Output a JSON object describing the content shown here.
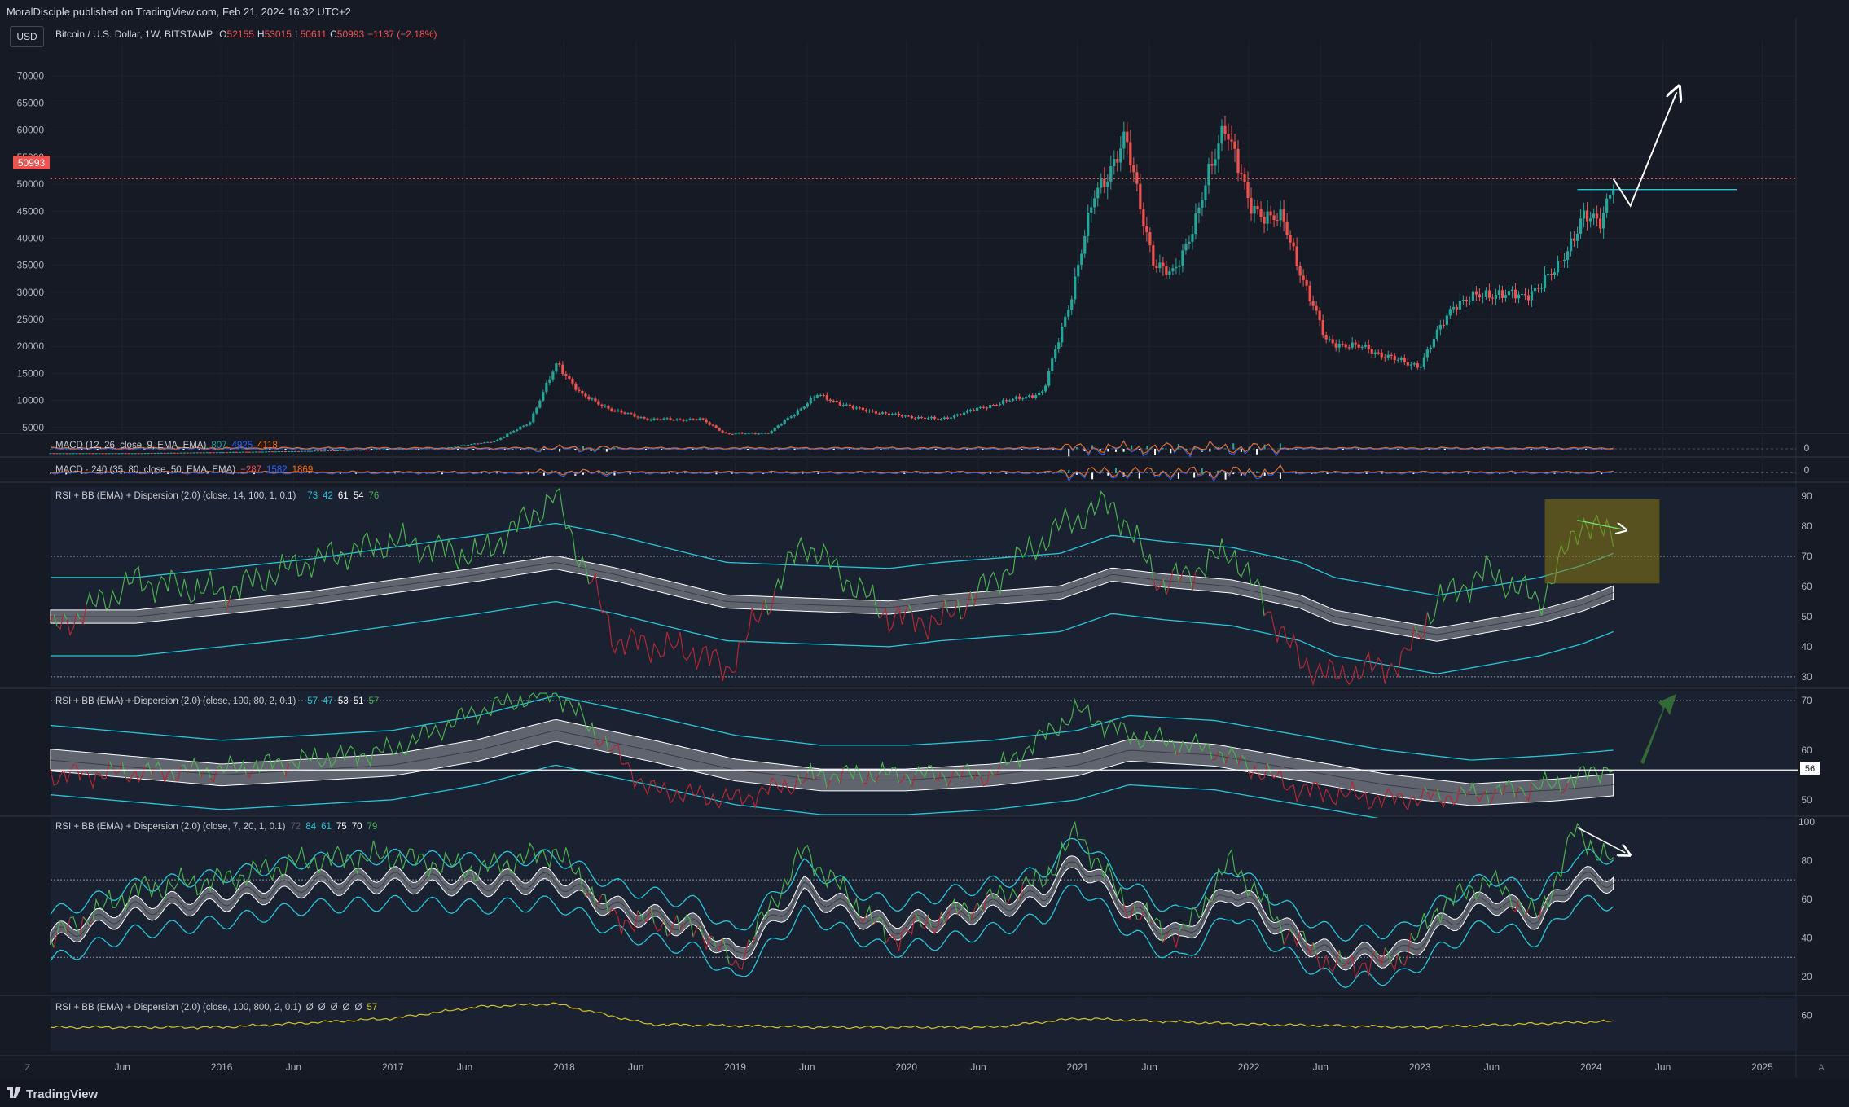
{
  "header": {
    "published": "MoralDisciple published on TradingView.com, Feb 21, 2024 16:32 UTC+2",
    "currency_button": "USD"
  },
  "symbol": {
    "name": "Bitcoin / U.S. Dollar, 1W, BITSTAMP",
    "open_label": "O",
    "open": "52155",
    "high_label": "H",
    "high": "53015",
    "low_label": "L",
    "low": "50611",
    "close_label": "C",
    "close": "50993",
    "change": "−1137 (−2.18%)",
    "last_price_badge": "50993"
  },
  "panes": {
    "macd1": {
      "label": "MACD (12, 26, close, 9, EMA, EMA)",
      "v1": "807",
      "v2": "4925",
      "v3": "4118",
      "zero": "0"
    },
    "macd2": {
      "label": "MACD · 240 (35, 80, close, 50, EMA, EMA)",
      "v1": "−287",
      "v2": "1582",
      "v3": "1869",
      "zero": "0"
    },
    "rsi1": {
      "label": "RSI + BB (EMA) + Dispersion (2.0) (close, 14, 100, 1, 0.1)",
      "values": [
        "73",
        "42",
        "61",
        "54",
        "76"
      ]
    },
    "rsi2": {
      "label": "RSI + BB (EMA) + Dispersion (2.0) (close, 100, 80, 2, 0.1)",
      "values": [
        "57",
        "47",
        "53",
        "51",
        "57"
      ],
      "level_badge": "56"
    },
    "rsi3": {
      "label": "RSI + BB (EMA) + Dispersion (2.0) (close, 7, 20, 1, 0.1)",
      "values": [
        "72",
        "84",
        "61",
        "75",
        "70",
        "79"
      ]
    },
    "rsi4": {
      "label": "RSI + BB (EMA) + Dispersion (2.0) (close, 100, 800, 2, 0.1)",
      "values": [
        "Ø",
        "Ø",
        "Ø",
        "Ø",
        "Ø",
        "57"
      ]
    }
  },
  "footer": {
    "brand": "TradingView",
    "z_button": "Z",
    "a_button": "A"
  },
  "colors": {
    "background": "#161a25",
    "up_candle": "#26a69a",
    "down_candle": "#ef5350",
    "rsi_up": "#4caf50",
    "rsi_down": "#b22833",
    "band": "#26c6da",
    "rsi_yellow": "#d4c02a"
  },
  "chart_data": [
    {
      "type": "candlestick",
      "title": "Bitcoin / U.S. Dollar, 1W, BITSTAMP",
      "ylim": [
        0,
        72000
      ],
      "y_ticks": [
        5000,
        10000,
        15000,
        20000,
        25000,
        30000,
        35000,
        40000,
        45000,
        50000,
        55000,
        60000,
        65000,
        70000
      ],
      "x_ticks": [
        "Jun",
        "2016",
        "Jun",
        "2017",
        "Jun",
        "2018",
        "Jun",
        "2019",
        "Jun",
        "2020",
        "Jun",
        "2021",
        "Jun",
        "2022",
        "Jun",
        "2023",
        "Jun",
        "2024",
        "Jun",
        "2025"
      ],
      "x_tick_dates": [
        2015.42,
        2016.0,
        2016.42,
        2017.0,
        2017.42,
        2018.0,
        2018.42,
        2019.0,
        2019.42,
        2020.0,
        2020.42,
        2021.0,
        2021.42,
        2022.0,
        2022.42,
        2023.0,
        2023.42,
        2024.0,
        2024.42,
        2025.0
      ],
      "series": [
        {
          "name": "BTCUSD",
          "x": [
            2015.0,
            2015.5,
            2016.0,
            2016.5,
            2017.0,
            2017.3,
            2017.6,
            2017.8,
            2017.96,
            2018.1,
            2018.3,
            2018.5,
            2018.8,
            2018.95,
            2019.2,
            2019.48,
            2019.7,
            2019.95,
            2020.2,
            2020.5,
            2020.8,
            2020.96,
            2021.1,
            2021.28,
            2021.45,
            2021.55,
            2021.7,
            2021.86,
            2022.0,
            2022.2,
            2022.45,
            2022.7,
            2022.9,
            2023.0,
            2023.2,
            2023.45,
            2023.6,
            2023.8,
            2023.95,
            2024.05,
            2024.13
          ],
          "close": [
            250,
            260,
            430,
            650,
            1000,
            1200,
            2500,
            6000,
            17000,
            11000,
            8000,
            6500,
            6500,
            3800,
            4000,
            11000,
            8500,
            7200,
            6500,
            9200,
            11500,
            29000,
            48000,
            58000,
            35000,
            33000,
            44000,
            62000,
            46000,
            43000,
            21000,
            19500,
            17000,
            16500,
            28000,
            30000,
            29000,
            34000,
            44000,
            42500,
            50993
          ]
        }
      ],
      "annotations": {
        "horizontal_ray": 49000,
        "projection_arrow": [
          [
            2024.13,
            51000
          ],
          [
            2024.23,
            46000
          ],
          [
            2024.5,
            67000
          ]
        ],
        "last_price_line": 50993
      }
    },
    {
      "type": "line",
      "title": "MACD (12, 26, close, 9, EMA, EMA)",
      "y_ticks": [
        0
      ],
      "series": [
        {
          "name": "MACD",
          "values": [
            807
          ]
        },
        {
          "name": "Signal",
          "values": [
            4925
          ]
        },
        {
          "name": "Histogram",
          "values": [
            4118
          ]
        }
      ]
    },
    {
      "type": "line",
      "title": "MACD · 240 (35, 80, close, 50, EMA, EMA)",
      "y_ticks": [
        0
      ],
      "series": [
        {
          "name": "MACD",
          "values": [
            -287
          ]
        },
        {
          "name": "Signal",
          "values": [
            1582
          ]
        },
        {
          "name": "Histogram",
          "values": [
            1869
          ]
        }
      ]
    },
    {
      "type": "line",
      "title": "RSI + BB (EMA) + Dispersion (2.0) (close, 14, 100, 1, 0.1)",
      "ylim": [
        27,
        93
      ],
      "y_ticks": [
        30,
        40,
        50,
        60,
        70,
        80,
        90
      ],
      "x": [
        2015.0,
        2015.5,
        2016.0,
        2016.5,
        2017.0,
        2017.5,
        2017.95,
        2018.3,
        2018.8,
        2018.95,
        2019.4,
        2019.9,
        2020.2,
        2020.9,
        2021.2,
        2021.5,
        2021.9,
        2022.3,
        2022.5,
        2022.9,
        2023.1,
        2023.4,
        2023.7,
        2023.95,
        2024.13
      ],
      "series": [
        {
          "name": "RSI",
          "values": [
            45,
            62,
            58,
            68,
            75,
            70,
            90,
            42,
            38,
            32,
            75,
            50,
            48,
            80,
            88,
            60,
            72,
            35,
            30,
            35,
            55,
            65,
            55,
            82,
            76
          ]
        },
        {
          "name": "Basis",
          "values": [
            50,
            50,
            53,
            56,
            60,
            64,
            68,
            64,
            57,
            55,
            54,
            53,
            55,
            58,
            64,
            62,
            60,
            55,
            50,
            46,
            44,
            47,
            50,
            54,
            58
          ]
        }
      ],
      "annotations": {
        "levels": [
          30,
          70
        ],
        "highlight_box": [
          2023.73,
          2024.4,
          61,
          89
        ],
        "divergence_arrow": [
          [
            2023.92,
            82
          ],
          [
            2024.18,
            79
          ]
        ]
      }
    },
    {
      "type": "line",
      "title": "RSI + BB (EMA) + Dispersion (2.0) (close, 100, 80, 2, 0.1)",
      "ylim": [
        47,
        72
      ],
      "y_ticks": [
        50,
        60,
        70
      ],
      "x": [
        2015.0,
        2016.0,
        2017.0,
        2017.5,
        2017.95,
        2018.5,
        2019.0,
        2019.5,
        2020.0,
        2020.5,
        2021.0,
        2021.3,
        2021.8,
        2022.3,
        2022.8,
        2023.3,
        2023.8,
        2024.13
      ],
      "series": [
        {
          "name": "RSI",
          "values": [
            55,
            56,
            60,
            68,
            72,
            52,
            50,
            55,
            55,
            55,
            68,
            63,
            60,
            52,
            50,
            51,
            53,
            57
          ]
        },
        {
          "name": "Basis",
          "values": [
            58,
            55,
            57,
            60,
            64,
            60,
            56,
            54,
            54,
            55,
            57,
            60,
            59,
            56,
            53,
            51,
            52,
            53
          ]
        }
      ],
      "annotations": {
        "levels": [
          70
        ],
        "horizontal_level": 56,
        "up_arrow": true
      }
    },
    {
      "type": "line",
      "title": "RSI + BB (EMA) + Dispersion (2.0) (close, 7, 20, 1, 0.1)",
      "ylim": [
        12,
        102
      ],
      "y_ticks": [
        20,
        40,
        60,
        80,
        100
      ],
      "x": [
        2015.0,
        2015.5,
        2016.0,
        2016.5,
        2017.0,
        2017.5,
        2017.95,
        2018.3,
        2018.8,
        2019.0,
        2019.4,
        2019.9,
        2020.2,
        2020.8,
        2021.0,
        2021.3,
        2021.6,
        2021.9,
        2022.2,
        2022.5,
        2022.9,
        2023.1,
        2023.4,
        2023.7,
        2023.9,
        2024.13
      ],
      "series": [
        {
          "name": "RSI",
          "values": [
            40,
            65,
            70,
            80,
            82,
            75,
            85,
            50,
            45,
            25,
            85,
            40,
            50,
            70,
            95,
            55,
            40,
            80,
            45,
            25,
            30,
            55,
            70,
            50,
            95,
            79
          ]
        },
        {
          "name": "Basis",
          "values": [
            40,
            55,
            60,
            68,
            70,
            68,
            70,
            55,
            45,
            30,
            65,
            45,
            50,
            62,
            80,
            55,
            40,
            65,
            45,
            30,
            32,
            45,
            60,
            50,
            70,
            70
          ]
        }
      ],
      "annotations": {
        "levels": [
          30,
          70
        ],
        "divergence_arrow": [
          [
            2023.92,
            97
          ],
          [
            2024.2,
            84
          ]
        ]
      }
    },
    {
      "type": "line",
      "title": "RSI + BB (EMA) + Dispersion (2.0) (close, 100, 800, 2, 0.1)",
      "ylim": [
        48,
        66
      ],
      "y_ticks": [
        60
      ],
      "x": [
        2015.0,
        2016.0,
        2017.0,
        2017.5,
        2017.95,
        2018.5,
        2019.5,
        2020.5,
        2021.0,
        2021.5,
        2022.0,
        2023.0,
        2024.13
      ],
      "series": [
        {
          "name": "RSI",
          "values": [
            56,
            56,
            59,
            63,
            64,
            57,
            56,
            56,
            59,
            58,
            57,
            56,
            58
          ]
        }
      ]
    }
  ]
}
